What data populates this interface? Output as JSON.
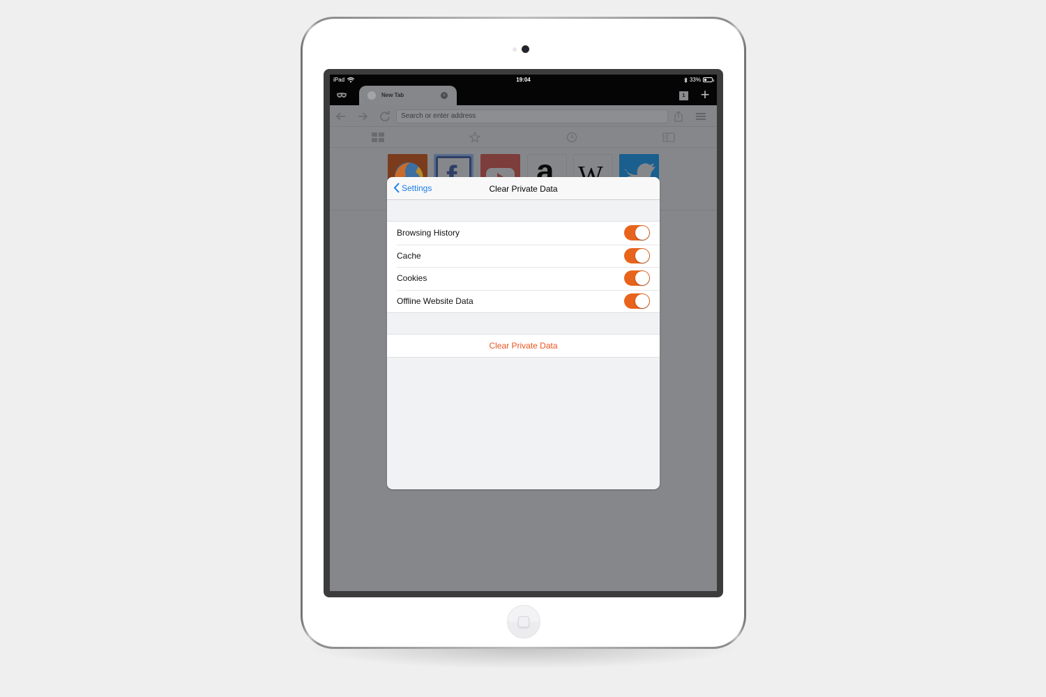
{
  "device": {
    "name": "iPad"
  },
  "status_bar": {
    "carrier": "iPad",
    "time": "19:04",
    "battery_percent_label": "33%",
    "battery_level": 0.33,
    "icons": [
      "wifi-icon",
      "bluetooth-icon",
      "battery-icon"
    ]
  },
  "browser": {
    "private_mode_icon": "mask-icon",
    "tab": {
      "title": "New Tab",
      "favicon": "globe-icon",
      "close_glyph": "×"
    },
    "tabs_count": "1",
    "new_tab_glyph": "+",
    "address_placeholder": "Search or enter address",
    "nav_icons": [
      "back-arrow-icon",
      "forward-arrow-icon",
      "reload-icon",
      "share-icon",
      "menu-icon"
    ],
    "panels": [
      "top-sites-icon",
      "bookmarks-icon",
      "history-icon",
      "reading-list-icon"
    ],
    "top_sites": [
      {
        "name": "Firefox",
        "color": "#e66000"
      },
      {
        "name": "Facebook",
        "color": "#3b5998"
      },
      {
        "name": "YouTube",
        "color": "#e52d27"
      },
      {
        "name": "Amazon",
        "color": "#ffffff"
      },
      {
        "name": "Wikipedia",
        "color": "#ffffff"
      },
      {
        "name": "Twitter",
        "color": "#1da1f2"
      }
    ]
  },
  "modal": {
    "back_label": "Settings",
    "title": "Clear Private Data",
    "options": [
      {
        "label": "Browsing History",
        "enabled": true
      },
      {
        "label": "Cache",
        "enabled": true
      },
      {
        "label": "Cookies",
        "enabled": true
      },
      {
        "label": "Offline Website Data",
        "enabled": true
      }
    ],
    "action_label": "Clear Private Data"
  },
  "colors": {
    "accent_orange": "#e8641c",
    "destructive_text": "#e8541c",
    "link_blue": "#1a7ce8"
  }
}
